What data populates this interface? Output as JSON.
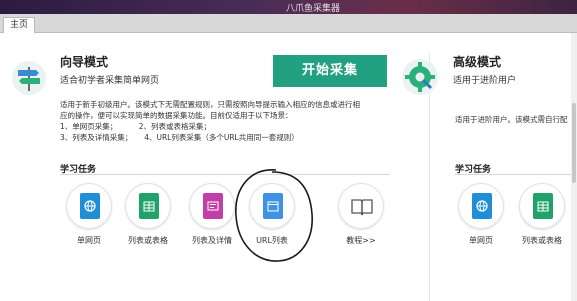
{
  "window": {
    "title": "八爪鱼采集器"
  },
  "tabs": [
    {
      "label": "主页"
    }
  ],
  "wizard": {
    "title": "向导模式",
    "subtitle": "适合初学者采集简单网页",
    "start_label": "开始采集",
    "description": [
      "适用于新手初级用户。该模式下无需配置规则，只需按照向导提示输入相应的信息或进行相",
      "应的操作，便可以实现简单的数据采集功能。目前仅适用于以下场景：",
      "1、单网页采集；         2、列表或表格采集；",
      "3、列表及详情采集；     4、URL列表采集（多个URL共用同一套规则）"
    ],
    "tasks_title": "学习任务",
    "tasks": [
      {
        "label": "单网页",
        "color": "#1e8fd6"
      },
      {
        "label": "列表或表格",
        "color": "#21a26a"
      },
      {
        "label": "列表及详情",
        "color": "#c33fa8"
      },
      {
        "label": "URL列表",
        "color": "#3f93e2"
      },
      {
        "label": "教程>>",
        "color": "#5b5b5b"
      }
    ]
  },
  "advanced": {
    "title": "高级模式",
    "subtitle": "适用于进阶用户",
    "description": "适用于进阶用户。该模式需自行配",
    "tasks_title": "学习任务",
    "tasks": [
      {
        "label": "单网页",
        "color": "#1e8fd6"
      },
      {
        "label": "列表或表格",
        "color": "#21a26a"
      }
    ]
  },
  "colors": {
    "accent": "#21a082",
    "titlebar": "#4a2d57"
  }
}
